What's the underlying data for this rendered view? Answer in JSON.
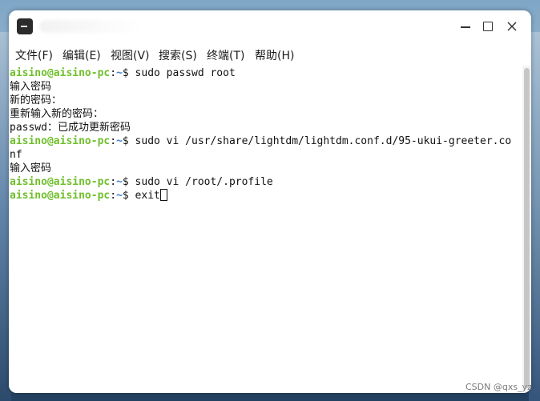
{
  "window": {
    "title": ""
  },
  "menubar": {
    "items": [
      {
        "label": "文件(F)"
      },
      {
        "label": "编辑(E)"
      },
      {
        "label": "视图(V)"
      },
      {
        "label": "搜索(S)"
      },
      {
        "label": "终端(T)"
      },
      {
        "label": "帮助(H)"
      }
    ]
  },
  "terminal": {
    "prompt_user": "aisino@aisino-pc",
    "prompt_colon": ":",
    "prompt_path": "~",
    "prompt_symbol": "$ ",
    "lines": [
      {
        "type": "cmd",
        "text": "sudo passwd root"
      },
      {
        "type": "out",
        "text": "输入密码"
      },
      {
        "type": "out",
        "text": "新的密码："
      },
      {
        "type": "out",
        "text": "重新输入新的密码："
      },
      {
        "type": "out",
        "text": "passwd：已成功更新密码"
      },
      {
        "type": "cmd",
        "text": "sudo vi /usr/share/lightdm/lightdm.conf.d/95-ukui-greeter.co"
      },
      {
        "type": "out",
        "text": "nf"
      },
      {
        "type": "out",
        "text": "输入密码"
      },
      {
        "type": "cmd",
        "text": "sudo vi /root/.profile"
      },
      {
        "type": "cmd",
        "text": "exit"
      }
    ]
  },
  "watermark": {
    "text": "CSDN @qxs_yz"
  },
  "colors": {
    "prompt_user": "#6fbf2a",
    "prompt_path": "#3a7fd0",
    "text": "#111111",
    "background": "#ffffff"
  }
}
